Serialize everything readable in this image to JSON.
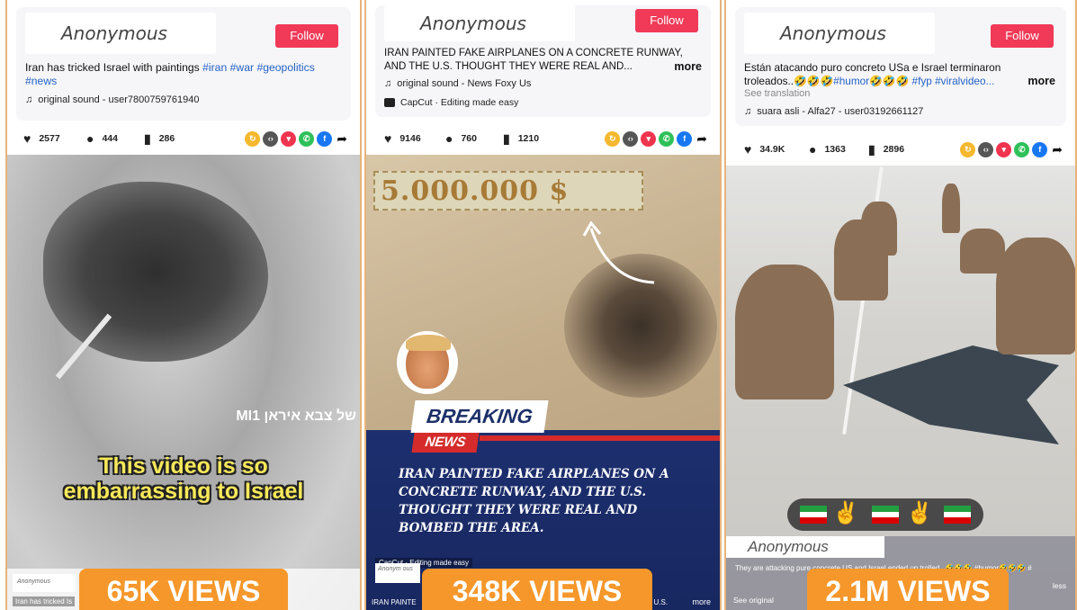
{
  "accent_colors": {
    "follow": "#f03a57",
    "views": "#f5972a",
    "hashtag": "#2462c7",
    "frame": "#e7b37a"
  },
  "panels": [
    {
      "author": "Anonymous",
      "follow_label": "Follow",
      "caption_text": "Iran has tricked Israel with paintings ",
      "hashtags": [
        "#iran",
        "#war",
        "#geopolitics",
        "#news"
      ],
      "sound": "original sound - user7800759761940",
      "stats": {
        "likes": "2577",
        "comments": "444",
        "saves": "286"
      },
      "video": {
        "overlay_hebrew": "MI1 של צבא איראן",
        "subtitle_line1": "This video is so",
        "subtitle_line2": "embarrassing to Israel",
        "mini_author": "Anonymous",
        "mini_caption": "Iran has tricked Is"
      },
      "views": "65K VIEWS"
    },
    {
      "author": "Anonymous",
      "follow_label": "Follow",
      "caption_line1": "IRAN PAINTED FAKE AIRPLANES ON A CONCRETE RUNWAY,",
      "caption_line2": "AND THE U.S. THOUGHT THEY WERE REAL AND...",
      "more_label": "more",
      "sound": "original sound - News Foxy Us",
      "capcut": "CapCut · Editing made easy",
      "stats": {
        "likes": "9146",
        "comments": "760",
        "saves": "1210"
      },
      "video": {
        "money": "5.000.000 $",
        "breaking": "BREAKING",
        "news": "NEWS",
        "headline": "IRAN PAINTED FAKE AIRPLANES ON A CONCRETE RUNWAY, AND THE U.S. THOUGHT THEY WERE REAL AND BOMBED THE AREA.",
        "capcut_overlay": "CapCut · Editing made easy",
        "mini_author": "Anonym ous",
        "mini_left": "IRAN PAINTE",
        "mini_right": "E U.S.",
        "mini_more": "more"
      },
      "views": "348K VIEWS"
    },
    {
      "author": "Anonymous",
      "follow_label": "Follow",
      "caption_line1": "Están atacando puro concreto USa e Israel terminaron",
      "caption_line2_pre": "troleados..🤣🤣🤣",
      "hashtags": [
        "#humor",
        "#fyp",
        "#viralvideo..."
      ],
      "emoji_mid": "🤣🤣🤣",
      "more_label": "more",
      "see_translation": "See translation",
      "sound": "suara asli - Alfa27 - user03192661127",
      "stats": {
        "likes": "34.9K",
        "comments": "1363",
        "saves": "2896"
      },
      "video": {
        "mini_author": "Anonymous",
        "mini_caption": "They are attacking pure concrete US and Israel ended up trolled...🤣🤣🤣 #humor🤣🤣🤣 #",
        "see_original": "See original",
        "less": "less"
      },
      "views": "2.1M VIEWS"
    }
  ],
  "icons": [
    "heart-icon",
    "comment-icon",
    "bookmark-icon",
    "repost-icon",
    "embed-icon",
    "send-icon",
    "whatsapp-icon",
    "facebook-icon",
    "share-arrow-icon",
    "music-note-icon",
    "capcut-icon"
  ]
}
